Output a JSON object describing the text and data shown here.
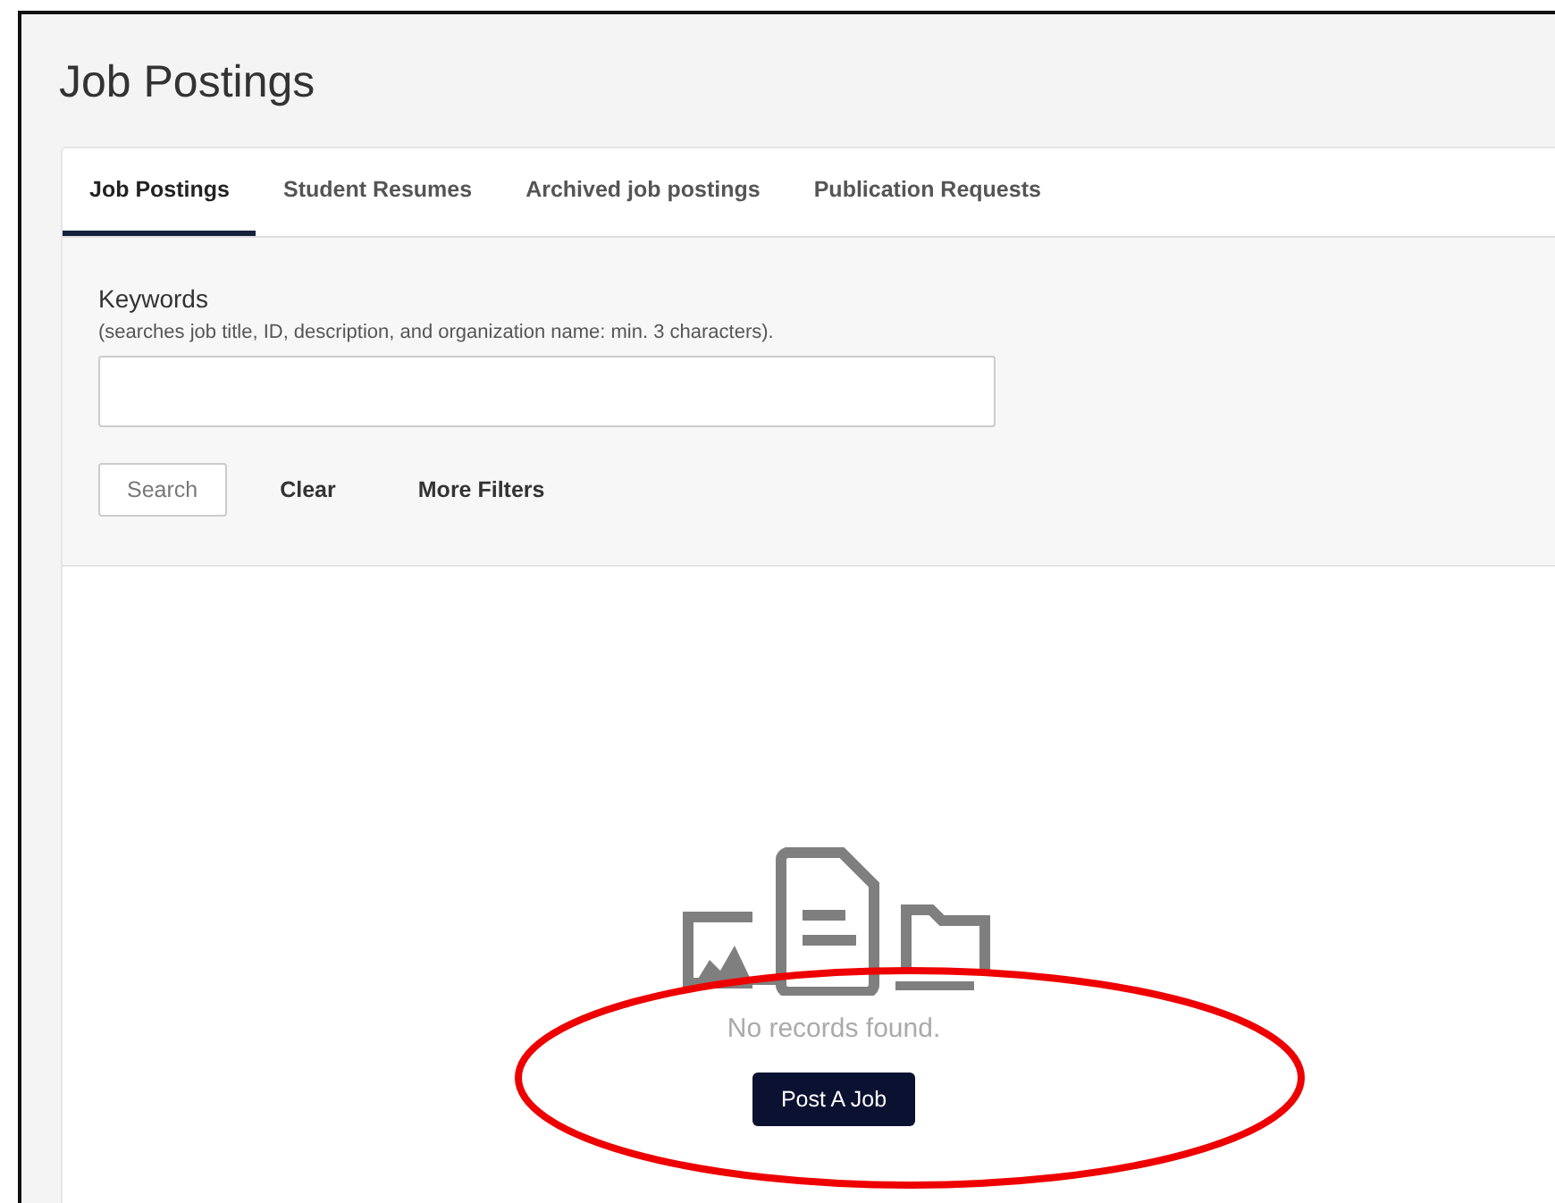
{
  "page": {
    "title": "Job Postings"
  },
  "tabs": [
    {
      "label": "Job Postings",
      "selected": true
    },
    {
      "label": "Student Resumes",
      "selected": false
    },
    {
      "label": "Archived job postings",
      "selected": false
    },
    {
      "label": "Publication Requests",
      "selected": false
    }
  ],
  "filters": {
    "label": "Keywords",
    "hint": "(searches job title, ID, description, and organization name: min. 3 characters).",
    "buttons": [
      {
        "label": "Search",
        "kind": "outlined"
      },
      {
        "label": "Clear",
        "kind": "text"
      },
      {
        "label": "More Filters",
        "kind": "text"
      }
    ]
  },
  "empty_state": {
    "message": "No records found.",
    "action": "Post A Job"
  }
}
